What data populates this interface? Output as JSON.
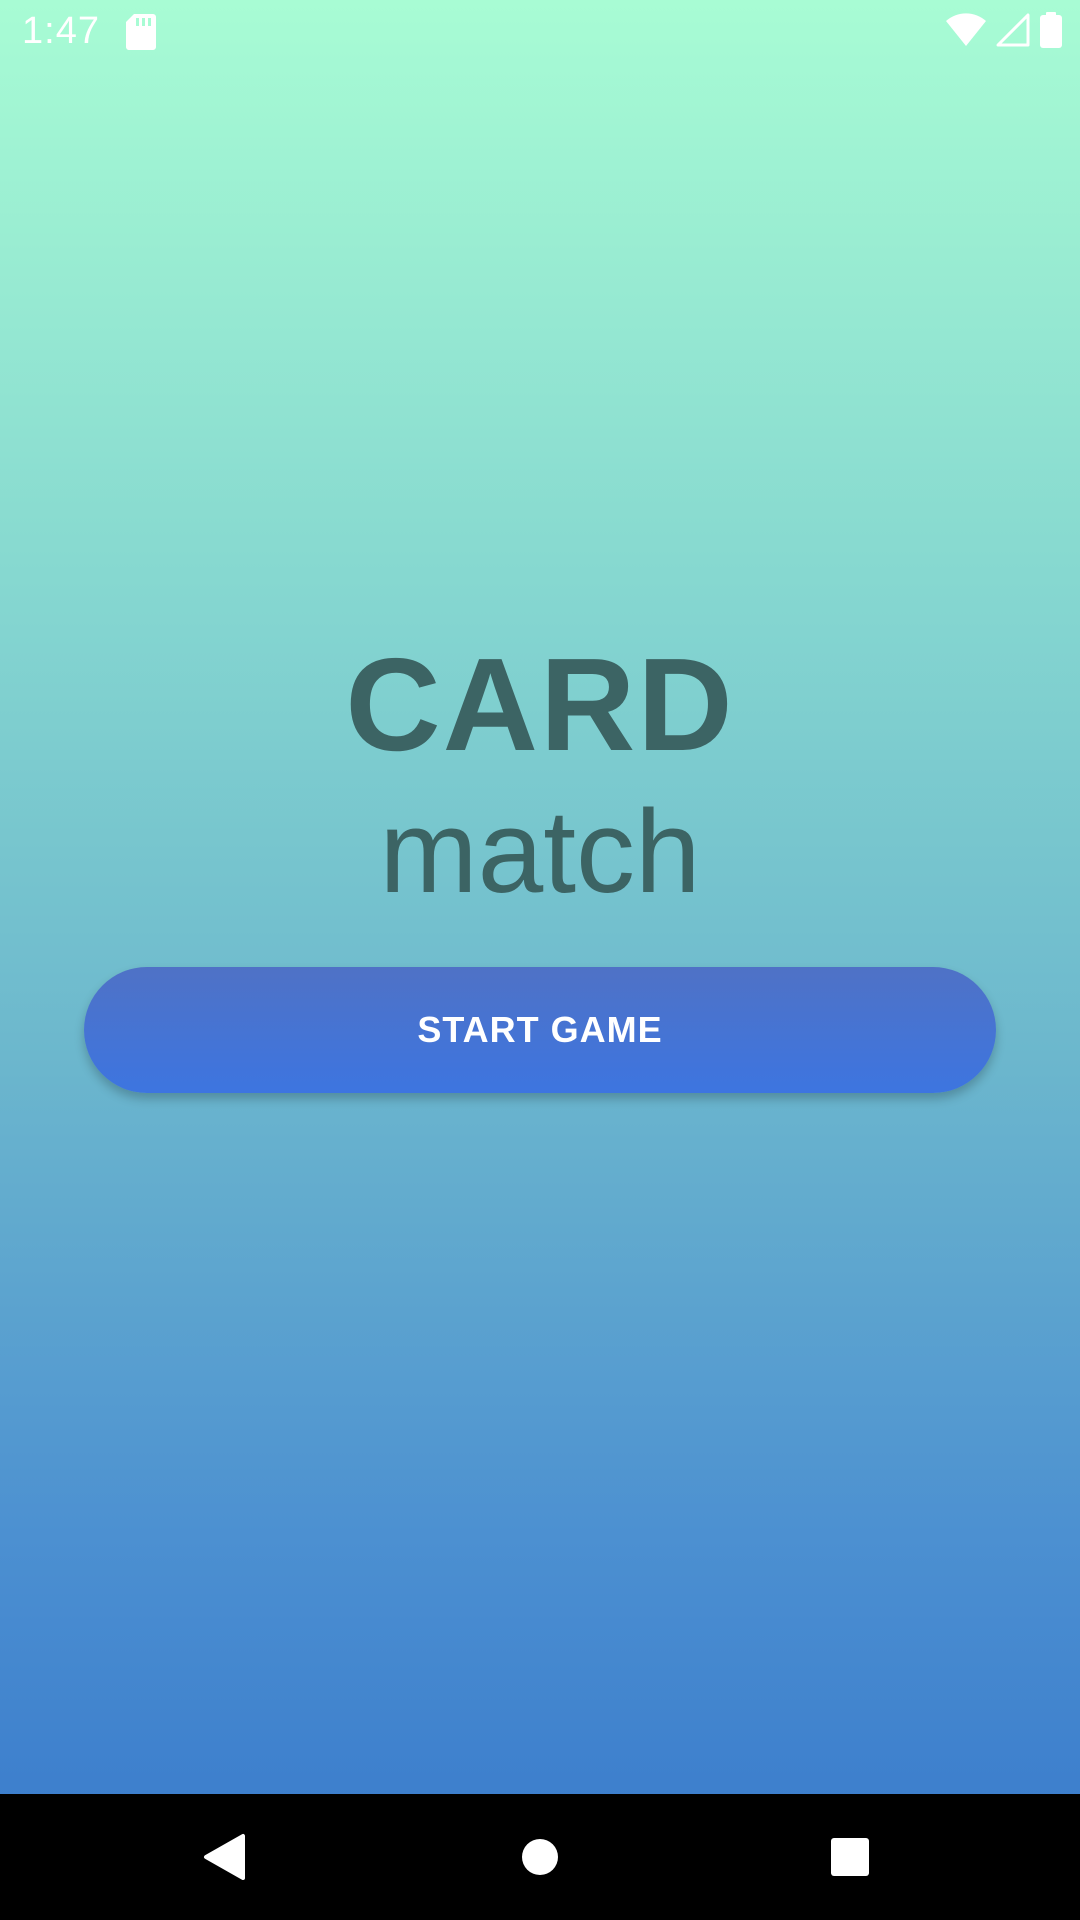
{
  "status_bar": {
    "time": "1:47",
    "icons": [
      "sd-card-icon",
      "wifi-icon",
      "cell-signal-icon",
      "battery-icon"
    ]
  },
  "title": {
    "line1": "CARD",
    "line2": "match"
  },
  "start_button": {
    "label": "START GAME"
  },
  "nav_bar": {
    "icons": [
      "back-icon",
      "home-icon",
      "recents-icon"
    ]
  },
  "colors": {
    "gradient_top": "#a8fcd4",
    "gradient_bottom": "#3677cb",
    "title_text": "#3c6464",
    "button": "#3d75e0",
    "nav_bar": "#000000"
  }
}
